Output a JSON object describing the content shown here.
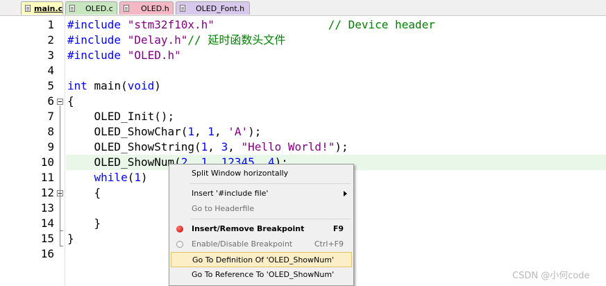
{
  "tabs": [
    {
      "label": "main.c",
      "active": true,
      "color": "#ffffc0"
    },
    {
      "label": "OLED.c",
      "active": false,
      "color": "#c8e6c0"
    },
    {
      "label": "OLED.h",
      "active": false,
      "color": "#f4b8c4"
    },
    {
      "label": "OLED_Font.h",
      "active": false,
      "color": "#d8c8ec"
    }
  ],
  "editor": {
    "line_numbers": [
      "1",
      "2",
      "3",
      "4",
      "5",
      "6",
      "7",
      "8",
      "9",
      "10",
      "11",
      "12",
      "13",
      "14",
      "15",
      "16"
    ],
    "highlighted_line": "10",
    "lines": [
      {
        "t": [
          {
            "c": "pp",
            "v": "#include "
          },
          {
            "c": "str",
            "v": "\"stm32f10x.h\""
          },
          {
            "c": "",
            "v": "                 "
          },
          {
            "c": "cmt",
            "v": "// Device header"
          }
        ]
      },
      {
        "t": [
          {
            "c": "pp",
            "v": "#include "
          },
          {
            "c": "str",
            "v": "\"Delay.h\""
          },
          {
            "c": "cmt",
            "v": "// "
          },
          {
            "c": "cmtc",
            "v": "延时函数头文件"
          }
        ]
      },
      {
        "t": [
          {
            "c": "pp",
            "v": "#include "
          },
          {
            "c": "str",
            "v": "\"OLED.h\""
          }
        ]
      },
      {
        "t": []
      },
      {
        "t": [
          {
            "c": "kw",
            "v": "int"
          },
          {
            "c": "",
            "v": " main("
          },
          {
            "c": "kw",
            "v": "void"
          },
          {
            "c": "",
            "v": ")"
          }
        ]
      },
      {
        "t": [
          {
            "c": "",
            "v": "{"
          }
        ]
      },
      {
        "t": [
          {
            "c": "",
            "v": "    OLED_Init();"
          }
        ]
      },
      {
        "t": [
          {
            "c": "",
            "v": "    OLED_ShowChar("
          },
          {
            "c": "num",
            "v": "1"
          },
          {
            "c": "",
            "v": ", "
          },
          {
            "c": "num",
            "v": "1"
          },
          {
            "c": "",
            "v": ", "
          },
          {
            "c": "chr",
            "v": "'A'"
          },
          {
            "c": "",
            "v": ");"
          }
        ]
      },
      {
        "t": [
          {
            "c": "",
            "v": "    OLED_ShowString("
          },
          {
            "c": "num",
            "v": "1"
          },
          {
            "c": "",
            "v": ", "
          },
          {
            "c": "num",
            "v": "3"
          },
          {
            "c": "",
            "v": ", "
          },
          {
            "c": "str",
            "v": "\"Hello World!\""
          },
          {
            "c": "",
            "v": ");"
          }
        ]
      },
      {
        "t": [
          {
            "c": "",
            "v": "    OLED_ShowNum("
          },
          {
            "c": "num",
            "v": "2"
          },
          {
            "c": "",
            "v": ", "
          },
          {
            "c": "num",
            "v": "1"
          },
          {
            "c": "",
            "v": ", "
          },
          {
            "c": "num",
            "v": "12345"
          },
          {
            "c": "",
            "v": ", "
          },
          {
            "c": "num",
            "v": "4"
          },
          {
            "c": "",
            "v": ");"
          }
        ]
      },
      {
        "t": [
          {
            "c": "",
            "v": "    "
          },
          {
            "c": "kw",
            "v": "while"
          },
          {
            "c": "",
            "v": "("
          },
          {
            "c": "num",
            "v": "1"
          },
          {
            "c": "",
            "v": ")"
          }
        ]
      },
      {
        "t": [
          {
            "c": "",
            "v": "    {"
          }
        ]
      },
      {
        "t": []
      },
      {
        "t": [
          {
            "c": "",
            "v": "    }"
          }
        ]
      },
      {
        "t": [
          {
            "c": "",
            "v": "}"
          }
        ]
      },
      {
        "t": []
      }
    ]
  },
  "context_menu": {
    "items": [
      {
        "label": "Split Window horizontally",
        "shortcut": "",
        "disabled": false,
        "bold": false,
        "selected": false,
        "icon": "",
        "submenu": false
      },
      {
        "sep": true
      },
      {
        "label": "Insert '#include file'",
        "shortcut": "",
        "disabled": false,
        "bold": false,
        "selected": false,
        "icon": "",
        "submenu": true
      },
      {
        "label": "Go to Headerfile",
        "shortcut": "",
        "disabled": true,
        "bold": false,
        "selected": false,
        "icon": "",
        "submenu": false
      },
      {
        "sep": true
      },
      {
        "label": "Insert/Remove Breakpoint",
        "shortcut": "F9",
        "disabled": false,
        "bold": true,
        "selected": false,
        "icon": "breakpoint-icon",
        "submenu": false
      },
      {
        "label": "Enable/Disable Breakpoint",
        "shortcut": "Ctrl+F9",
        "disabled": true,
        "bold": false,
        "selected": false,
        "icon": "breakpoint-disabled-icon",
        "submenu": false
      },
      {
        "label": "Go To Definition Of 'OLED_ShowNum'",
        "shortcut": "",
        "disabled": false,
        "bold": false,
        "selected": true,
        "icon": "",
        "submenu": false
      },
      {
        "label": "Go To Reference To 'OLED_ShowNum'",
        "shortcut": "",
        "disabled": false,
        "bold": false,
        "selected": false,
        "icon": "",
        "submenu": false
      }
    ]
  },
  "watermark": "CSDN @小何code"
}
